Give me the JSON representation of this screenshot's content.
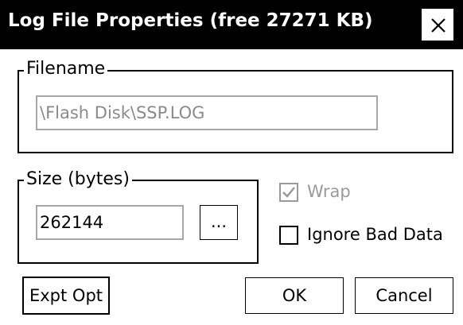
{
  "window": {
    "title": "Log File Properties (free 27271 KB)",
    "close_label": "Close"
  },
  "filename_group": {
    "legend": "Filename",
    "path_value": "\\Flash Disk\\SSP.LOG"
  },
  "size_group": {
    "legend": "Size (bytes)",
    "size_value": "262144",
    "browse_label": "..."
  },
  "options": {
    "wrap_label": "Wrap",
    "wrap_checked": true,
    "wrap_enabled": false,
    "ignore_bad_data_label": "Ignore Bad Data",
    "ignore_bad_data_checked": false
  },
  "buttons": {
    "expt_opt_label": "Expt Opt",
    "ok_label": "OK",
    "cancel_label": "Cancel"
  },
  "colors": {
    "titlebar": "#000000",
    "disabled_text": "#8a8a8a",
    "field_border": "#a8a8a8"
  }
}
